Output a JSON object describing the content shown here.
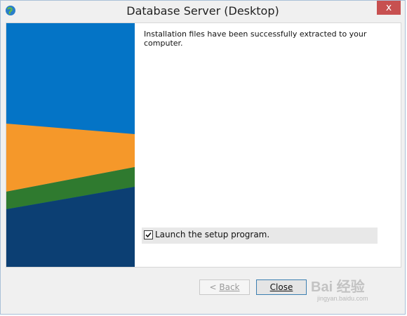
{
  "window": {
    "title": "Database Server (Desktop)",
    "close_glyph": "x"
  },
  "content": {
    "message": "Installation files have been successfully extracted to your computer.",
    "launch_checkbox": {
      "label": "Launch the setup program.",
      "checked": true
    }
  },
  "buttons": {
    "back_prefix": "< ",
    "back_label": "Back",
    "close_label": "Close"
  },
  "side_panel_colors": {
    "blue": "#0474c6",
    "orange": "#f5982a",
    "green": "#2f7a2f",
    "navy": "#0c3f73"
  },
  "watermark": {
    "text": "Bai 经验",
    "sub": "jingyan.baidu.com"
  },
  "icons": {
    "app": "globe-icon",
    "close": "close-icon",
    "check": "check-icon"
  }
}
